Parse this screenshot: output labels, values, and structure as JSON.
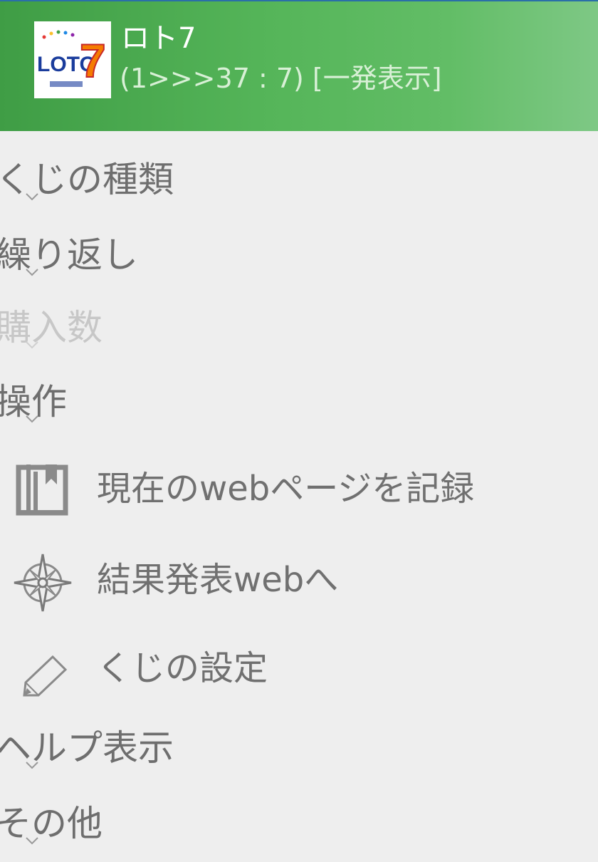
{
  "header": {
    "title": "ロト7",
    "subtitle": "(1>>>37 : 7) [一発表示]",
    "logo_text": "LOTO 7",
    "logo_icon": "loto7-logo"
  },
  "menu": {
    "lottery_type": "くじの種類",
    "repeat": "繰り返し",
    "purchase_count": "購入数",
    "operation": "操作",
    "record_web_page": "現在のwebページを記録",
    "results_web": "結果発表webへ",
    "lottery_settings": "くじの設定",
    "help": "ヘルプ表示",
    "other": "その他"
  },
  "icons": {
    "bookmark": "bookmark-icon",
    "compass": "compass-icon",
    "edit": "pencil-icon",
    "expand": "chevron-down-icon"
  },
  "colors": {
    "header_start": "#3f9d45",
    "header_end": "#7ec885",
    "text": "#6e6e6e",
    "disabled_text": "#c7c7c7",
    "background": "#eeeeee"
  }
}
